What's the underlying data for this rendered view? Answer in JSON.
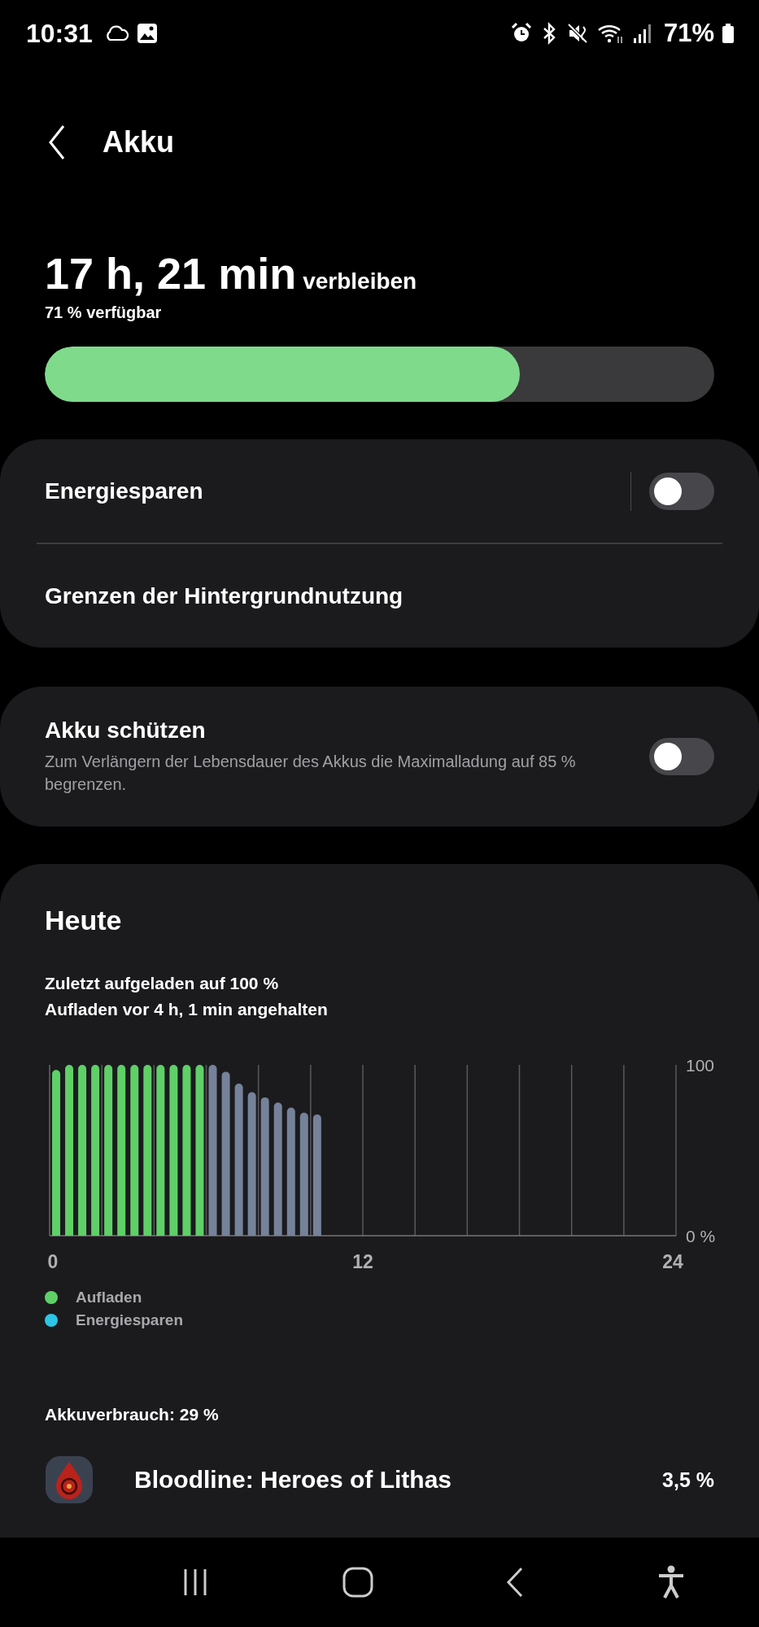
{
  "status_bar": {
    "time": "10:31",
    "battery": "71%"
  },
  "header": {
    "title": "Akku"
  },
  "battery": {
    "remaining_value": "17 h, 21 min",
    "remaining_label": "verbleiben",
    "available": "71 % verfügbar",
    "level": 0.71
  },
  "settings_card": [
    {
      "label": "Energiesparen",
      "kind": "toggle",
      "on": false
    },
    {
      "label": "Grenzen der Hintergrundnutzung",
      "kind": "link"
    }
  ],
  "protect_card": {
    "title": "Akku schützen",
    "description": "Zum Verlängern der Lebensdauer des Akkus die Maximalladung auf 85 % begrenzen.",
    "on": false
  },
  "today": {
    "title": "Heute",
    "last_charged": "Zuletzt aufgeladen auf 100 %",
    "charging_stopped": "Aufladen vor 4 h, 1 min angehalten",
    "chart_data": {
      "type": "bar",
      "stacked": true,
      "x": [
        0.25,
        0.75,
        1.25,
        1.75,
        2.25,
        2.75,
        3.25,
        3.75,
        4.25,
        4.75,
        5.25,
        5.75,
        6.25,
        6.75,
        7.25,
        7.75,
        8.25,
        8.75,
        9.25,
        9.75,
        10.25
      ],
      "series": [
        {
          "name": "Aufladen",
          "color": "#5fd068",
          "values": [
            97,
            100,
            100,
            100,
            100,
            100,
            100,
            100,
            100,
            100,
            100,
            100,
            null,
            null,
            null,
            null,
            null,
            null,
            null,
            null,
            null
          ]
        },
        {
          "name": "Energiesparen",
          "color": "#2cc6e6",
          "values": [
            null,
            null,
            null,
            null,
            null,
            null,
            null,
            null,
            null,
            null,
            null,
            null,
            null,
            null,
            null,
            null,
            null,
            null,
            null,
            null,
            null
          ]
        },
        {
          "color": "#76829a",
          "values": [
            null,
            null,
            null,
            null,
            null,
            null,
            null,
            null,
            null,
            null,
            null,
            null,
            100,
            96,
            89,
            84,
            81,
            78,
            75,
            72,
            71
          ]
        }
      ],
      "xlim": [
        0,
        24
      ],
      "ylim": [
        0,
        100
      ],
      "xticks": [
        0,
        12,
        24
      ],
      "yticks": [
        {
          "value": 0,
          "label": "0 %"
        },
        100
      ]
    },
    "usage": "Akkuverbrauch: 29 %",
    "apps": [
      {
        "name": "Bloodline: Heroes of Lithas",
        "percent": "3,5 %"
      }
    ]
  }
}
